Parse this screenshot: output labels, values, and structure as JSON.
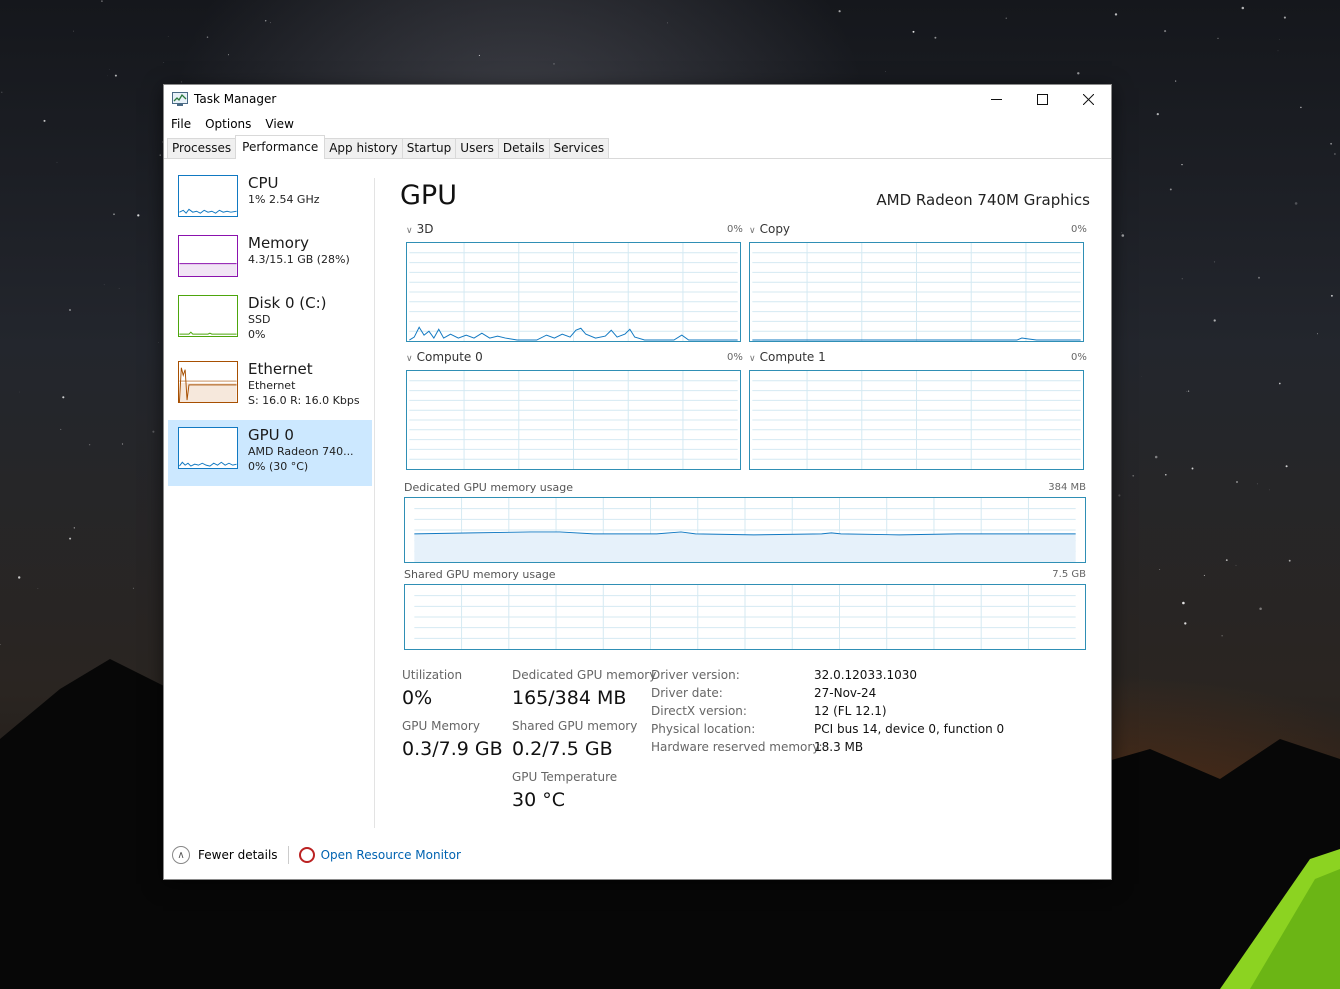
{
  "window": {
    "title": "Task Manager"
  },
  "menu": [
    "File",
    "Options",
    "View"
  ],
  "tabs": [
    "Processes",
    "Performance",
    "App history",
    "Startup",
    "Users",
    "Details",
    "Services"
  ],
  "sidebar": {
    "items": [
      {
        "name": "CPU",
        "line1": "1%  2.54 GHz",
        "line2": "",
        "color": "#1179c2"
      },
      {
        "name": "Memory",
        "line1": "4.3/15.1 GB (28%)",
        "line2": "",
        "color": "#8b12ae"
      },
      {
        "name": "Disk 0 (C:)",
        "line1": "SSD",
        "line2": "0%",
        "color": "#4da60c"
      },
      {
        "name": "Ethernet",
        "line1": "Ethernet",
        "line2": "S: 16.0  R: 16.0 Kbps",
        "color": "#a74f01"
      },
      {
        "name": "GPU 0",
        "line1": "AMD Radeon 740...",
        "line2": "0%  (30 °C)",
        "color": "#1179c2"
      }
    ]
  },
  "main": {
    "title": "GPU",
    "model": "AMD Radeon 740M Graphics",
    "engines": [
      {
        "label": "3D",
        "pct": "0%"
      },
      {
        "label": "Copy",
        "pct": "0%"
      },
      {
        "label": "Compute 0",
        "pct": "0%"
      },
      {
        "label": "Compute 1",
        "pct": "0%"
      }
    ],
    "dedicated": {
      "label": "Dedicated GPU memory usage",
      "max": "384 MB"
    },
    "shared": {
      "label": "Shared GPU memory usage",
      "max": "7.5 GB"
    }
  },
  "stats": {
    "utilization": {
      "label": "Utilization",
      "value": "0%"
    },
    "dedicated_mem": {
      "label": "Dedicated GPU memory",
      "value": "165/384 MB"
    },
    "gpu_mem": {
      "label": "GPU Memory",
      "value": "0.3/7.9 GB"
    },
    "shared_mem": {
      "label": "Shared GPU memory",
      "value": "0.2/7.5 GB"
    },
    "temperature": {
      "label": "GPU Temperature",
      "value": "30 °C"
    }
  },
  "props": [
    {
      "label": "Driver version:",
      "value": "32.0.12033.1030"
    },
    {
      "label": "Driver date:",
      "value": "27-Nov-24"
    },
    {
      "label": "DirectX version:",
      "value": "12 (FL 12.1)"
    },
    {
      "label": "Physical location:",
      "value": "PCI bus 14, device 0, function 0"
    },
    {
      "label": "Hardware reserved memory:",
      "value": "18.3 MB"
    }
  ],
  "footer": {
    "fewer": "Fewer details",
    "resmon": "Open Resource Monitor"
  },
  "colors": {
    "gpu_line": "#1179c2",
    "graph_border": "#2f8fb5",
    "grid": "#d4e9f2",
    "link": "#0063b1"
  }
}
